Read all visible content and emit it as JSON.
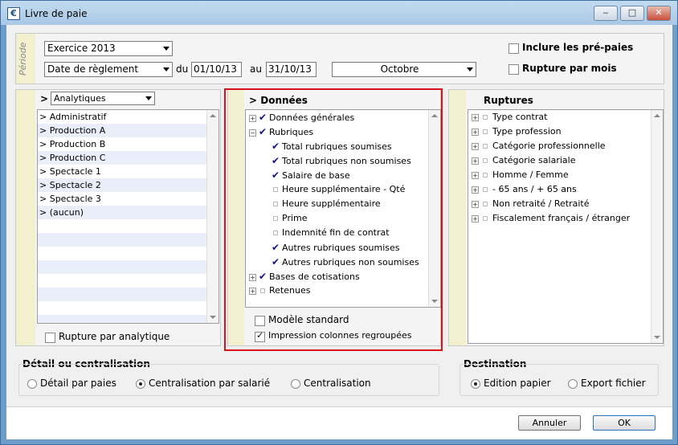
{
  "window": {
    "title": "Livre de paie",
    "icon": "€",
    "controls": {
      "minimize": "‒",
      "maximize": "□",
      "close": "✕"
    }
  },
  "periode": {
    "label": "Période",
    "exercice": "Exercice 2013",
    "date_type": "Date de règlement",
    "du_label": "du",
    "du_value": "01/10/13",
    "au_label": "au",
    "au_value": "31/10/13",
    "mois": "Octobre",
    "inclure_prepaies": {
      "label": "Inclure les pré-paies",
      "checked": false
    },
    "rupture_mois": {
      "label": "Rupture par mois",
      "checked": false
    }
  },
  "left_panel": {
    "arrow": ">",
    "combo": "Analytiques",
    "items": [
      ">  Administratif",
      ">  Production A",
      ">  Production B",
      ">  Production C",
      ">  Spectacle 1",
      ">  Spectacle 2",
      ">  Spectacle 3",
      ">  (aucun)"
    ],
    "empty_rows": 8,
    "rupture_analytique": {
      "label": "Rupture par analytique",
      "checked": false
    }
  },
  "middle_panel": {
    "header": ">  Données",
    "items": [
      {
        "label": "Données générales",
        "expander": "+",
        "checked": true,
        "level": 0
      },
      {
        "label": "Rubriques",
        "expander": "−",
        "checked": true,
        "level": 0
      },
      {
        "label": "Total rubriques soumises",
        "checked": true,
        "level": 1
      },
      {
        "label": "Total rubriques non soumises",
        "checked": true,
        "level": 1
      },
      {
        "label": "Salaire de base",
        "checked": true,
        "level": 1
      },
      {
        "label": "Heure supplémentaire - Qté",
        "checked": false,
        "level": 1
      },
      {
        "label": "Heure supplémentaire",
        "checked": false,
        "level": 1
      },
      {
        "label": "Prime",
        "checked": false,
        "level": 1
      },
      {
        "label": "Indemnité fin de contrat",
        "checked": false,
        "level": 1
      },
      {
        "label": "Autres rubriques soumises",
        "checked": true,
        "level": 1
      },
      {
        "label": "Autres rubriques non soumises",
        "checked": true,
        "level": 1
      },
      {
        "label": "Bases de cotisations",
        "expander": "+",
        "checked": true,
        "level": 0
      },
      {
        "label": "Retenues",
        "expander": "+",
        "checked": false,
        "level": 0
      }
    ],
    "modele_standard": {
      "label": "Modèle standard",
      "checked": false
    },
    "impression_regroupees": {
      "label": "Impression colonnes regroupées",
      "checked": true
    }
  },
  "right_panel": {
    "header": "Ruptures",
    "items": [
      "Type contrat",
      "Type profession",
      "Catégorie professionnelle",
      "Catégorie salariale",
      "Homme / Femme",
      "- 65 ans / + 65 ans",
      "Non retraité / Retraité",
      "Fiscalement français / étranger"
    ]
  },
  "detail": {
    "title": "Détail ou centralisation",
    "options": [
      {
        "label": "Détail par paies",
        "selected": false
      },
      {
        "label": "Centralisation par salarié",
        "selected": true
      },
      {
        "label": "Centralisation",
        "selected": false
      }
    ]
  },
  "destination": {
    "title": "Destination",
    "options": [
      {
        "label": "Edition papier",
        "selected": true
      },
      {
        "label": "Export fichier",
        "selected": false
      }
    ]
  },
  "buttons": {
    "annuler": "Annuler",
    "ok": "OK"
  },
  "colors": {
    "highlight_border": "#d8111b",
    "side_bar": "#f2f0cf",
    "row_alt": "#e9eef8",
    "check": "#14148a"
  }
}
